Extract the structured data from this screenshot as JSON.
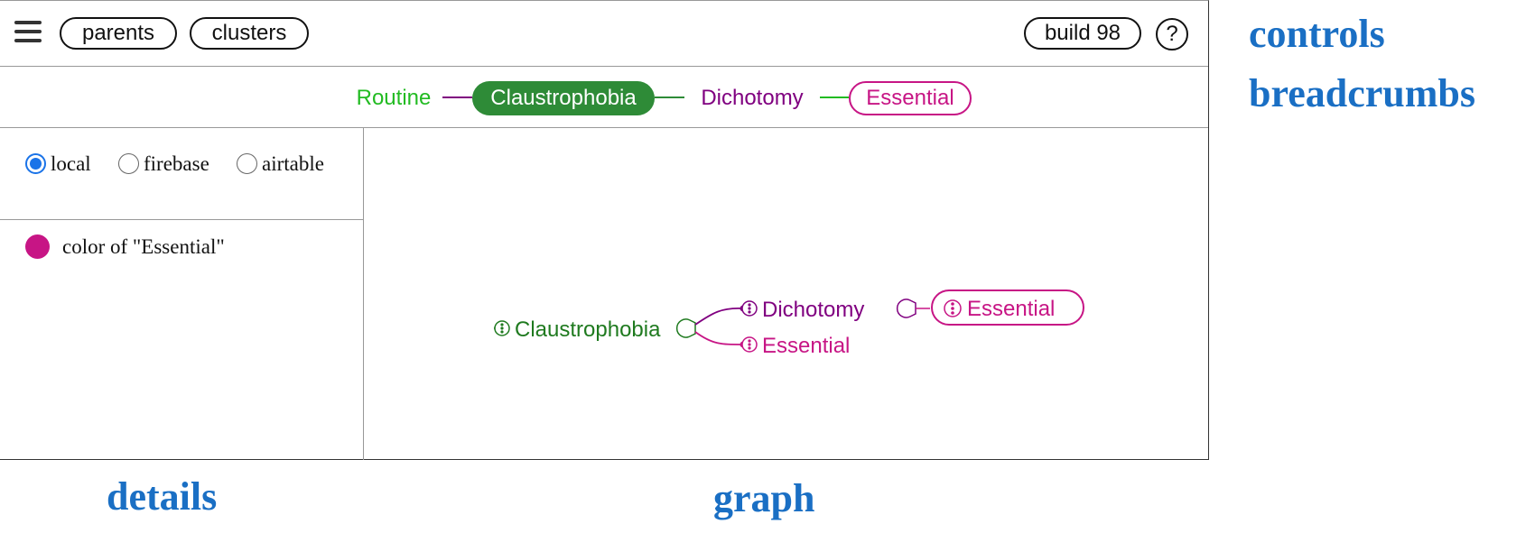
{
  "controls": {
    "parents_label": "parents",
    "clusters_label": "clusters",
    "build_label": "build 98",
    "help_label": "?"
  },
  "breadcrumbs": [
    {
      "label": "Routine",
      "color": "#22bb22",
      "style": "plain"
    },
    {
      "label": "Claustrophobia",
      "color": "#2e8b37",
      "style": "filled"
    },
    {
      "label": "Dichotomy",
      "color": "#800080",
      "style": "plain"
    },
    {
      "label": "Essential",
      "color": "#c71585",
      "style": "outlined"
    }
  ],
  "details": {
    "data_sources": [
      {
        "label": "local",
        "selected": true
      },
      {
        "label": "firebase",
        "selected": false
      },
      {
        "label": "airtable",
        "selected": false
      }
    ],
    "color_label": "color of \"Essential\"",
    "color_value": "#c71585"
  },
  "graph": {
    "root": {
      "label": "Claustrophobia",
      "color": "#1f7a1f"
    },
    "children": [
      {
        "label": "Dichotomy",
        "color": "#800080"
      },
      {
        "label": "Essential",
        "color": "#c71585"
      }
    ],
    "grandchild": {
      "label": "Essential",
      "color": "#c71585"
    }
  },
  "annotations": {
    "controls": "controls",
    "breadcrumbs": "breadcrumbs",
    "details": "details",
    "graph": "graph"
  }
}
